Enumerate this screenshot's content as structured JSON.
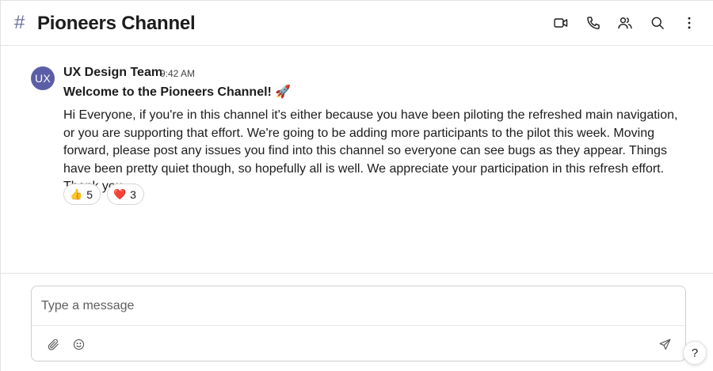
{
  "header": {
    "hash_symbol": "#",
    "channel_name": "Pioneers Channel",
    "icons": [
      "video-icon",
      "phone-icon",
      "members-icon",
      "search-icon",
      "more-vertical-icon"
    ]
  },
  "message": {
    "avatar_initials": "UX",
    "author": "UX Design Team",
    "time": "9:42 AM",
    "title": "Welcome to the Pioneers Channel!",
    "title_emoji": "🚀",
    "body": "Hi Everyone, if you're in this channel it's either because you have been piloting the refreshed main navigation, or you are supporting that effort. We're going to be adding more participants to the pilot this week. Moving forward, please post any issues you find into this channel so everyone can see bugs as they appear. Things have been pretty quiet though, so hopefully all is well. We appreciate your participation in this refresh effort. Thank you.",
    "reactions": [
      {
        "emoji": "👍",
        "count": "5"
      },
      {
        "emoji": "❤️",
        "count": "3"
      }
    ]
  },
  "composer": {
    "placeholder": "Type a message",
    "value": "",
    "icons": [
      "paperclip-icon",
      "emoji-icon",
      "send-icon"
    ]
  },
  "help": {
    "label": "?"
  },
  "colors": {
    "avatar_bg": "#5b5ea6",
    "hash": "#6b6f9e",
    "border": "#e3e3e3"
  }
}
